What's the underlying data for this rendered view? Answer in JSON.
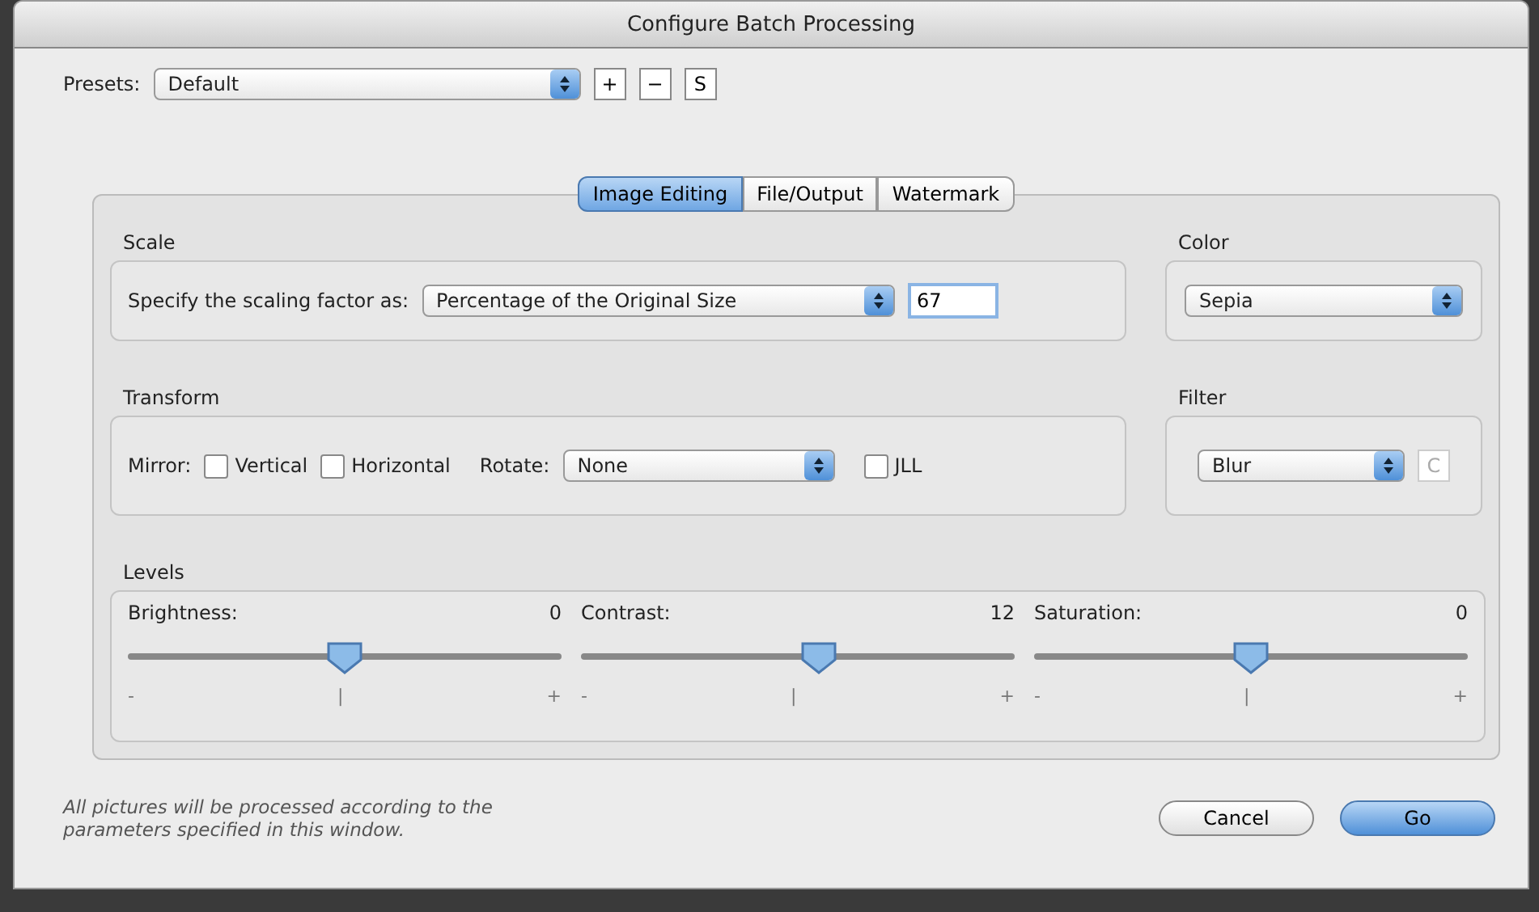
{
  "window": {
    "title": "Configure Batch Processing"
  },
  "presets": {
    "label": "Presets:",
    "value": "Default",
    "buttons": [
      "+",
      "−",
      "S"
    ]
  },
  "tabs": [
    {
      "label": "Image Editing",
      "selected": true
    },
    {
      "label": "File/Output",
      "selected": false
    },
    {
      "label": "Watermark",
      "selected": false
    }
  ],
  "scale": {
    "title": "Scale",
    "label": "Specify the scaling factor as:",
    "mode": "Percentage of the Original Size",
    "value": "67"
  },
  "color": {
    "title": "Color",
    "value": "Sepia"
  },
  "transform": {
    "title": "Transform",
    "mirror_label": "Mirror:",
    "checkboxes": [
      {
        "label": "Vertical",
        "checked": false
      },
      {
        "label": "Horizontal",
        "checked": false
      }
    ],
    "rotate_label": "Rotate:",
    "rotate": "None",
    "jll": {
      "label": "JLL",
      "checked": false
    }
  },
  "filter": {
    "title": "Filter",
    "value": "Blur",
    "button": "C"
  },
  "levels": {
    "title": "Levels",
    "sliders": [
      {
        "name": "Brightness:",
        "reading": "0",
        "level": 0.5,
        "min": "-",
        "mid": "|",
        "max": "+"
      },
      {
        "name": "Contrast:",
        "reading": "12",
        "level": 0.55,
        "min": "-",
        "mid": "|",
        "max": "+"
      },
      {
        "name": "Saturation:",
        "reading": "0",
        "level": 0.5,
        "min": "-",
        "mid": "|",
        "max": "+"
      }
    ]
  },
  "note": "All pictures will be processed according to the parameters specified in this window.",
  "buttons": [
    {
      "label": "Cancel",
      "kind": "normal"
    },
    {
      "label": "Go",
      "kind": "default"
    }
  ]
}
